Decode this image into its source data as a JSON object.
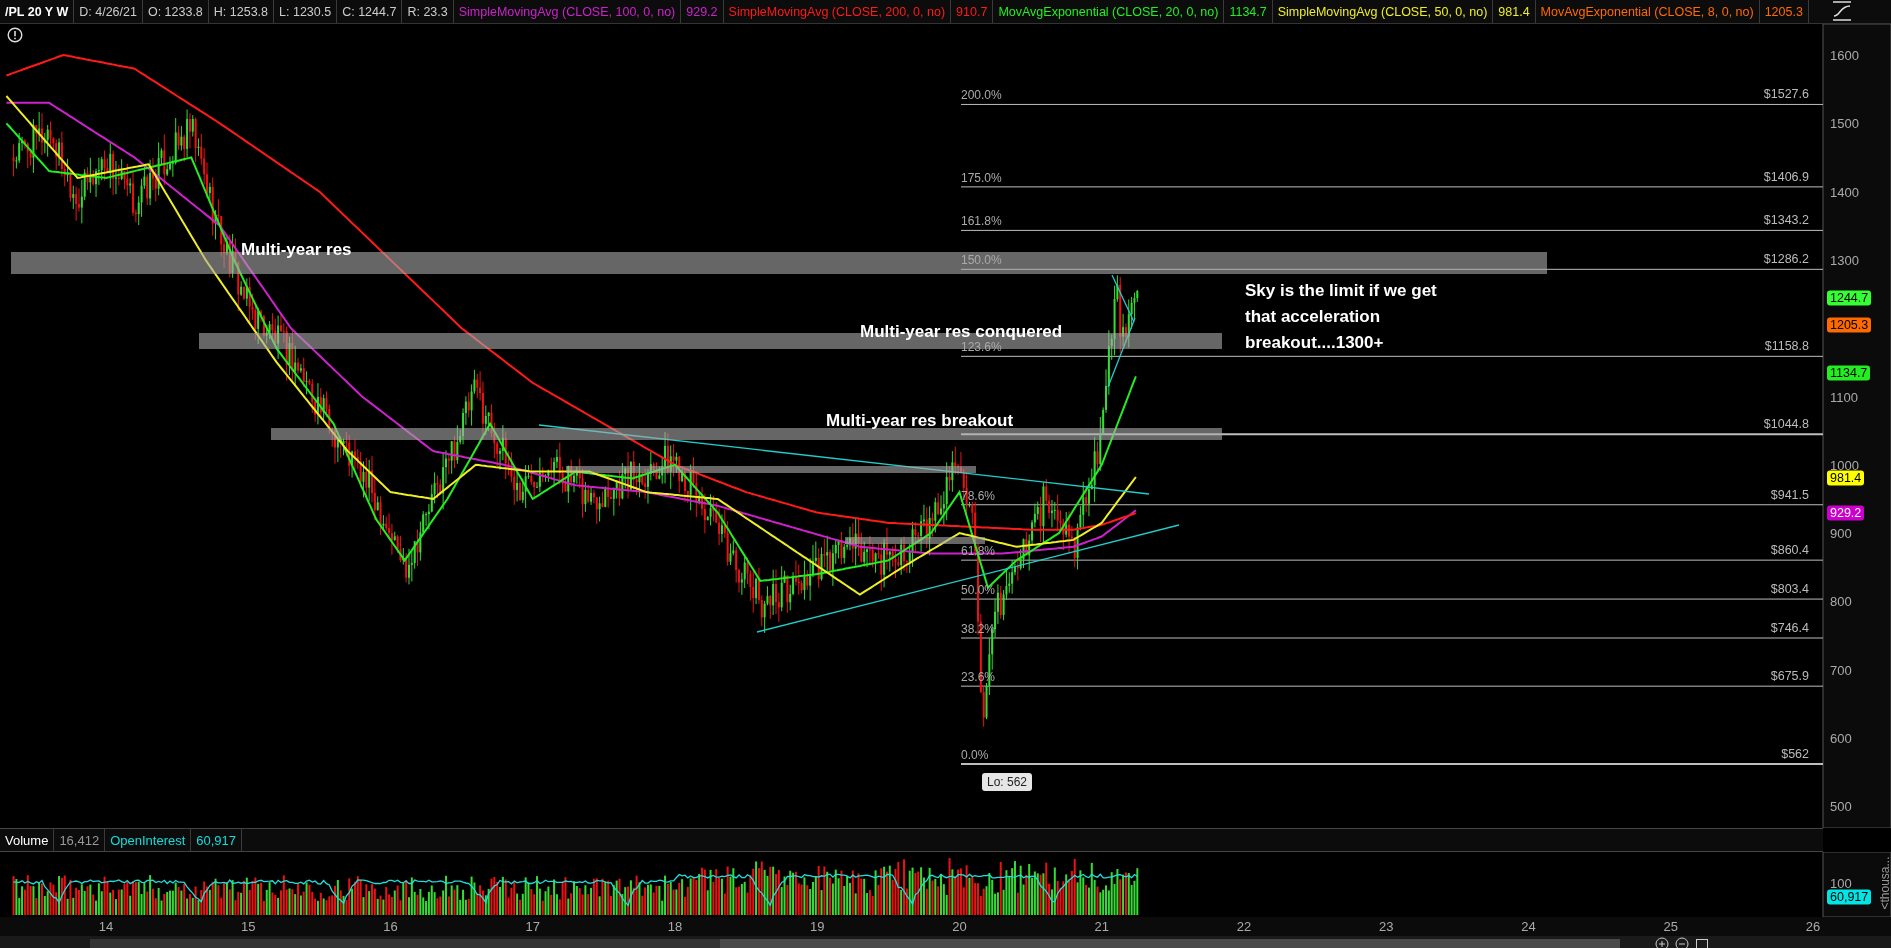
{
  "header": {
    "symbol": "/PL 20 Y W",
    "fields": [
      "D: 4/26/21",
      "O: 1233.8",
      "H: 1253.8",
      "L: 1230.5",
      "C: 1244.7",
      "R: 23.3"
    ],
    "studies": [
      {
        "label": "SimpleMovingAvg (CLOSE, 100, 0, no)",
        "value": "929.2",
        "color": "#cc22cc"
      },
      {
        "label": "SimpleMovingAvg (CLOSE, 200, 0, no)",
        "value": "910.7",
        "color": "#ff1a1a"
      },
      {
        "label": "MovAvgExponential (CLOSE, 20, 0, no)",
        "value": "1134.7",
        "color": "#22ee22"
      },
      {
        "label": "SimpleMovingAvg (CLOSE, 50, 0, no)",
        "value": "981.4",
        "color": "#eeee22"
      },
      {
        "label": "MovAvgExponential (CLOSE, 8, 0, no)",
        "value": "1205.3",
        "color": "#ff6a00"
      }
    ]
  },
  "price_chart": {
    "fib_levels": [
      {
        "percent": "200.0%",
        "price": "$1527.6"
      },
      {
        "percent": "175.0%",
        "price": "$1406.9"
      },
      {
        "percent": "161.8%",
        "price": "$1343.2"
      },
      {
        "percent": "150.0%",
        "price": "$1286.2"
      },
      {
        "percent": "123.6%",
        "price": "$1158.8"
      },
      {
        "price": "$1044.8"
      },
      {
        "percent": "78.6%",
        "price": "$941.5"
      },
      {
        "percent": "61.8%",
        "price": "$860.4"
      },
      {
        "percent": "50.0%",
        "price": "$803.4"
      },
      {
        "percent": "38.2%",
        "price": "$746.4"
      },
      {
        "percent": "23.6%",
        "price": "$675.9"
      },
      {
        "percent": "0.0%",
        "price": "$562"
      }
    ],
    "annotations": [
      "Multi-year res",
      "Multi-year res conquered",
      "Multi-year res breakout",
      "Sky is the limit if we get\nthat acceleration\nbreakout....1300+"
    ],
    "low_label": "Lo: 562",
    "y_axis": [
      "1600",
      "1500",
      "1400",
      "1300",
      "1100",
      "1000",
      "900",
      "800",
      "700",
      "600",
      "500"
    ],
    "price_badges": [
      {
        "value": "1244.7",
        "color": "#33ff33"
      },
      {
        "value": "1205.3",
        "color": "#ff6a00"
      },
      {
        "value": "1134.7",
        "color": "#22ee22"
      },
      {
        "value": "981.4",
        "color": "#ffff00"
      },
      {
        "value": "929.2",
        "color": "#cc00cc"
      }
    ]
  },
  "volume": {
    "label": "Volume",
    "value": "16,412",
    "oi_label": "OpenInterest",
    "oi_value": "60,917",
    "y_axis": [
      "100"
    ],
    "badge": {
      "value": "60,917",
      "color": "#00e5e5"
    },
    "unit": "<thousa..."
  },
  "x_axis": [
    "14",
    "15",
    "16",
    "17",
    "18",
    "19",
    "20",
    "21",
    "22",
    "23",
    "24",
    "25",
    "26"
  ]
}
